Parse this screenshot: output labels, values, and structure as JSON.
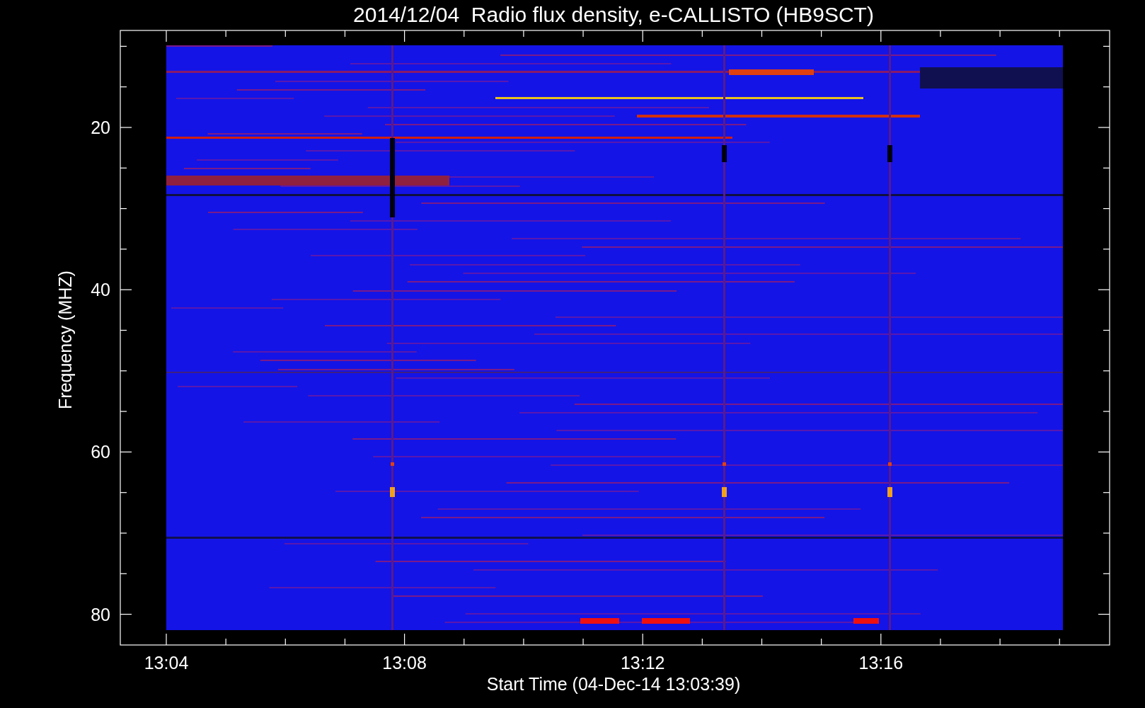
{
  "title": "2014/12/04  Radio flux density, e-CALLISTO (HB9SCT)",
  "y_axis": {
    "label": "Frequency (MHZ)",
    "ticks": [
      "20",
      "40",
      "60",
      "80"
    ]
  },
  "x_axis": {
    "label": "Start Time (04-Dec-14 13:03:39)",
    "ticks": [
      "13:04",
      "13:08",
      "13:12",
      "13:16"
    ]
  }
}
